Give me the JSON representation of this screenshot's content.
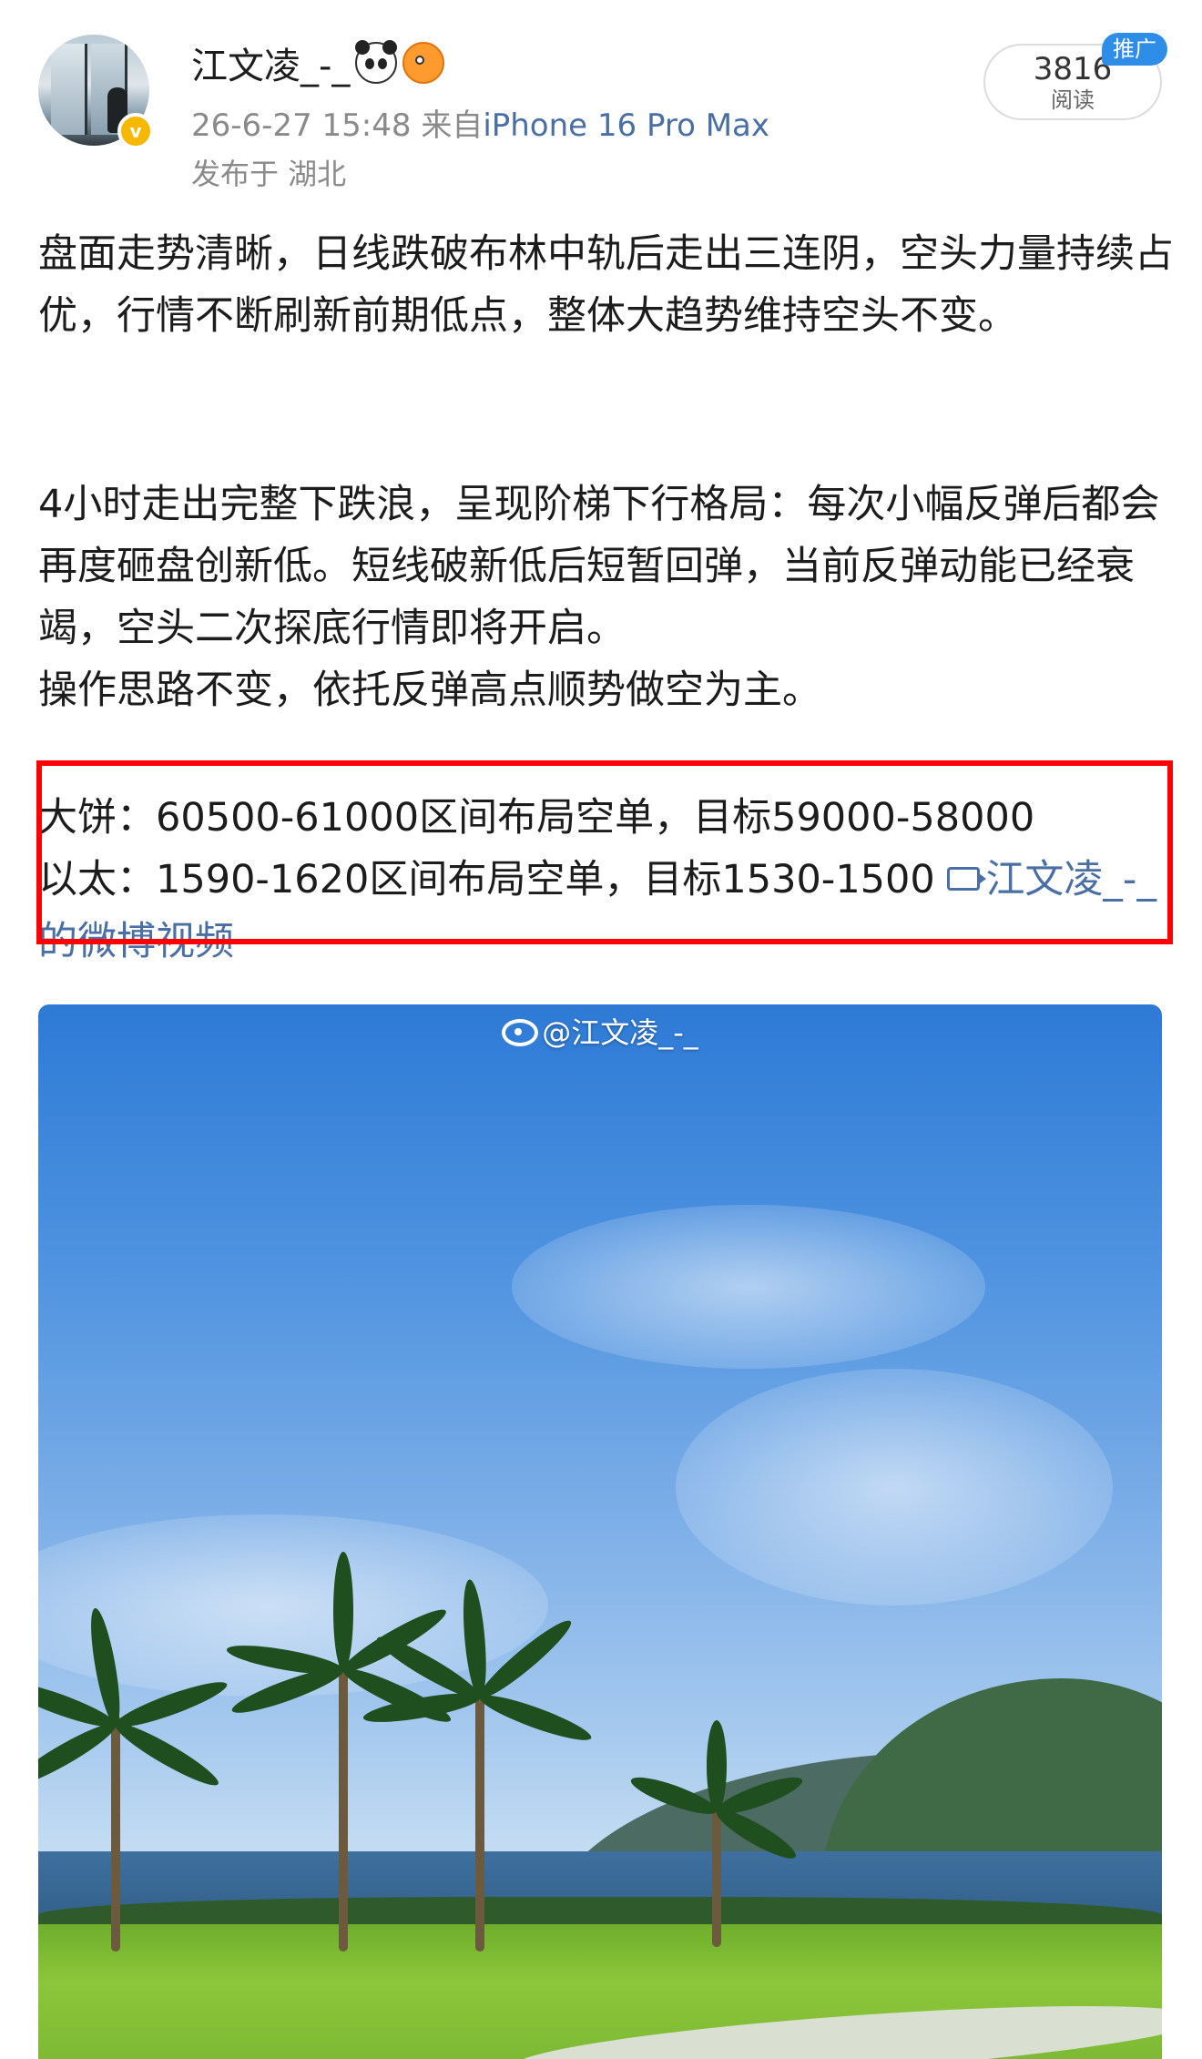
{
  "post": {
    "author": {
      "name": "江文凌_-_",
      "badges": [
        "panda-emoji",
        "fish-emoji"
      ],
      "verified_mark": "v"
    },
    "timestamp": "26-6-27 15:48",
    "source_prefix": "来自",
    "device": "iPhone 16 Pro Max",
    "location": "发布于 湖北",
    "reads": {
      "count": "3816",
      "label": "阅读"
    },
    "promo_tag": "推广",
    "paragraphs": [
      "盘面走势清晰，日线跌破布林中轨后走出三连阴，空头力量持续占优，行情不断刷新前期低点，整体大趋势维持空头不变。",
      "4小时走出完整下跌浪，呈现阶梯下行格局：每次小幅反弹后都会再度砸盘创新低。短线破新低后短暂回弹，当前反弹动能已经衰竭，空头二次探底行情即将开启。",
      "操作思路不变，依托反弹高点顺势做空为主。"
    ],
    "trades": [
      "大饼：60500-61000区间布局空单，目标59000-58000",
      "以太：1590-1620区间布局空单，目标1530-1500"
    ],
    "video_link": "江文凌_-_的微博视频",
    "video_watermark": "@江文凌_-_"
  },
  "colors": {
    "link": "#4a6fa5",
    "promo": "#2e8de6",
    "verified": "#f6b800",
    "highlight_box": "#ff0000"
  }
}
